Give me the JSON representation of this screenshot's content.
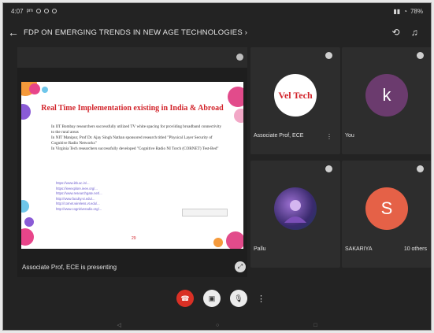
{
  "status": {
    "time": "4:07",
    "time_suffix": "pm",
    "battery": "78%"
  },
  "header": {
    "title": "FDP ON EMERGING TRENDS IN NEW AGE TECHNOLOGIES"
  },
  "slide": {
    "title": "Real Time Implementation existing in India & Abroad",
    "paragraphs": [
      "In IIT Bombay researchers successfully utilized TV white spacing for providing broadband connectivity to the rural areas",
      "In NIT Manipur, Prof Dr. Ajay Singh Nathan sponsored research titled \"Physical Layer Security of Cognitive Radio Networks\"",
      "In Virginia Tech researchers successfully developed \"Cognitive Radio NI Torch (CORNET) Test-Bed\""
    ],
    "links": [
      "https://www.iitb.ac.in/...",
      "https://ieeexplore.ieee.org/...",
      "https://www.researchgate.net/...",
      "http://www.faculty.vt.edu/...",
      "http://cornet.wireless.vt.edu/...",
      "http://www.cognitiveradio.org/..."
    ],
    "page_number": "29"
  },
  "presenter_label": "Associate Prof, ECE is presenting",
  "participants": [
    {
      "name": "Associate Prof, ECE",
      "avatar_text": "Vel Tech",
      "type": "logo"
    },
    {
      "name": "You",
      "avatar_text": "k",
      "type": "letter",
      "color": "#6b3b6e"
    },
    {
      "name": "Pallu",
      "avatar_text": "",
      "type": "image"
    },
    {
      "name": "SAKARIYA",
      "avatar_text": "S",
      "type": "letter",
      "color": "#e56147",
      "extra": "10 others"
    }
  ],
  "colors": {
    "end_call": "#d93025",
    "accent": "#e56147"
  }
}
